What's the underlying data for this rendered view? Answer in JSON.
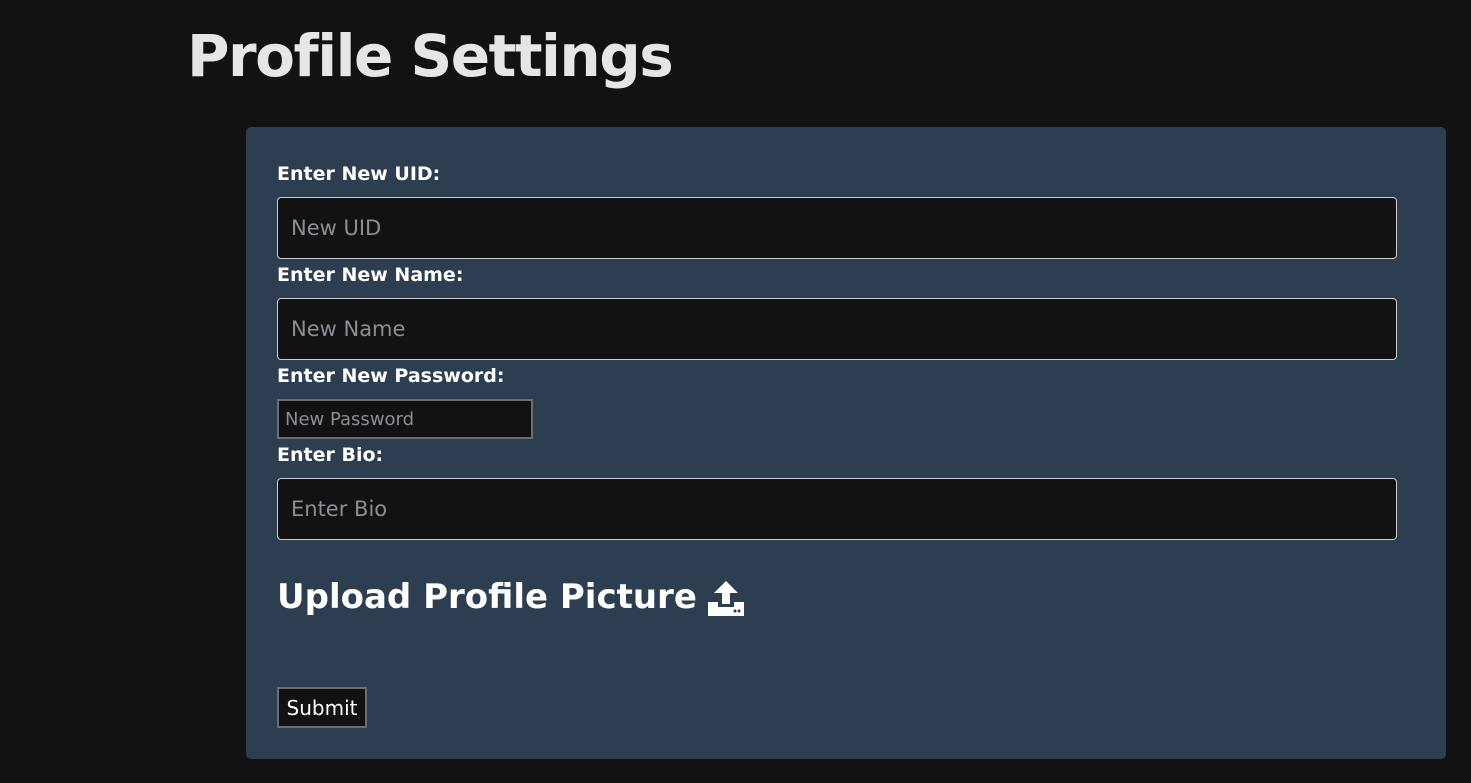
{
  "page": {
    "title": "Profile Settings"
  },
  "form": {
    "uid": {
      "label": "Enter New UID:",
      "placeholder": "New UID",
      "value": ""
    },
    "name": {
      "label": "Enter New Name:",
      "placeholder": "New Name",
      "value": ""
    },
    "password": {
      "label": "Enter New Password:",
      "placeholder": "New Password",
      "value": ""
    },
    "bio": {
      "label": "Enter Bio:",
      "placeholder": "Enter Bio",
      "value": ""
    },
    "upload": {
      "label": "Upload Profile Picture",
      "icon": "upload-icon"
    },
    "submit_label": "Submit"
  },
  "colors": {
    "page_background": "#121212",
    "card_background": "#2d3e50",
    "input_background": "#121212",
    "title_text": "#e6e6e6",
    "label_text": "#ffffff",
    "placeholder_text": "#8a8f95"
  }
}
